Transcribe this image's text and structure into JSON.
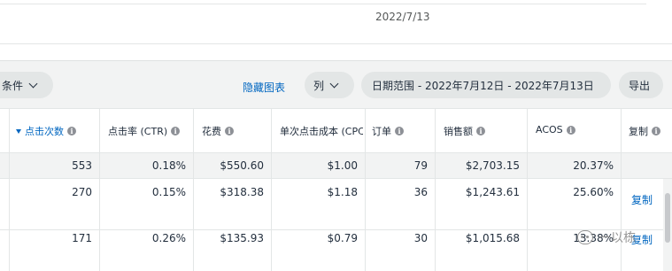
{
  "top": {
    "date": "2022/7/13"
  },
  "toolbar": {
    "filter_label": "条件",
    "hide_chart": "隐藏图表",
    "columns": "列",
    "date_range": "日期范围 - 2022年7月12日 - 2022年7月13日",
    "export": "导出"
  },
  "table": {
    "headers": {
      "clicks": "点击次数",
      "ctr": "点击率 (CTR)",
      "spend": "花费",
      "cpc": "单次点击成本 (CPC)",
      "orders": "订单",
      "sales": "销售额",
      "acos": "ACOS",
      "copy": "复制"
    },
    "sort_indicator": "sort-desc-icon",
    "total": {
      "clicks": "553",
      "ctr": "0.18%",
      "spend": "$550.60",
      "cpc": "$1.00",
      "orders": "79",
      "sales": "$2,703.15",
      "acos": "20.37%"
    },
    "rows": [
      {
        "clicks": "270",
        "ctr": "0.15%",
        "spend": "$318.38",
        "cpc": "$1.18",
        "orders": "36",
        "sales": "$1,243.61",
        "acos": "25.60%",
        "copy": "复制"
      },
      {
        "clicks": "171",
        "ctr": "0.26%",
        "spend": "$135.93",
        "cpc": "$0.79",
        "orders": "30",
        "sales": "$1,015.68",
        "acos": "13.38%",
        "copy": "复制"
      }
    ]
  },
  "watermark": {
    "text": "一以栋"
  },
  "colors": {
    "link": "#0066c0",
    "toolbar_bg": "#f2f3f3",
    "pill_bg": "#e3e6e6"
  }
}
